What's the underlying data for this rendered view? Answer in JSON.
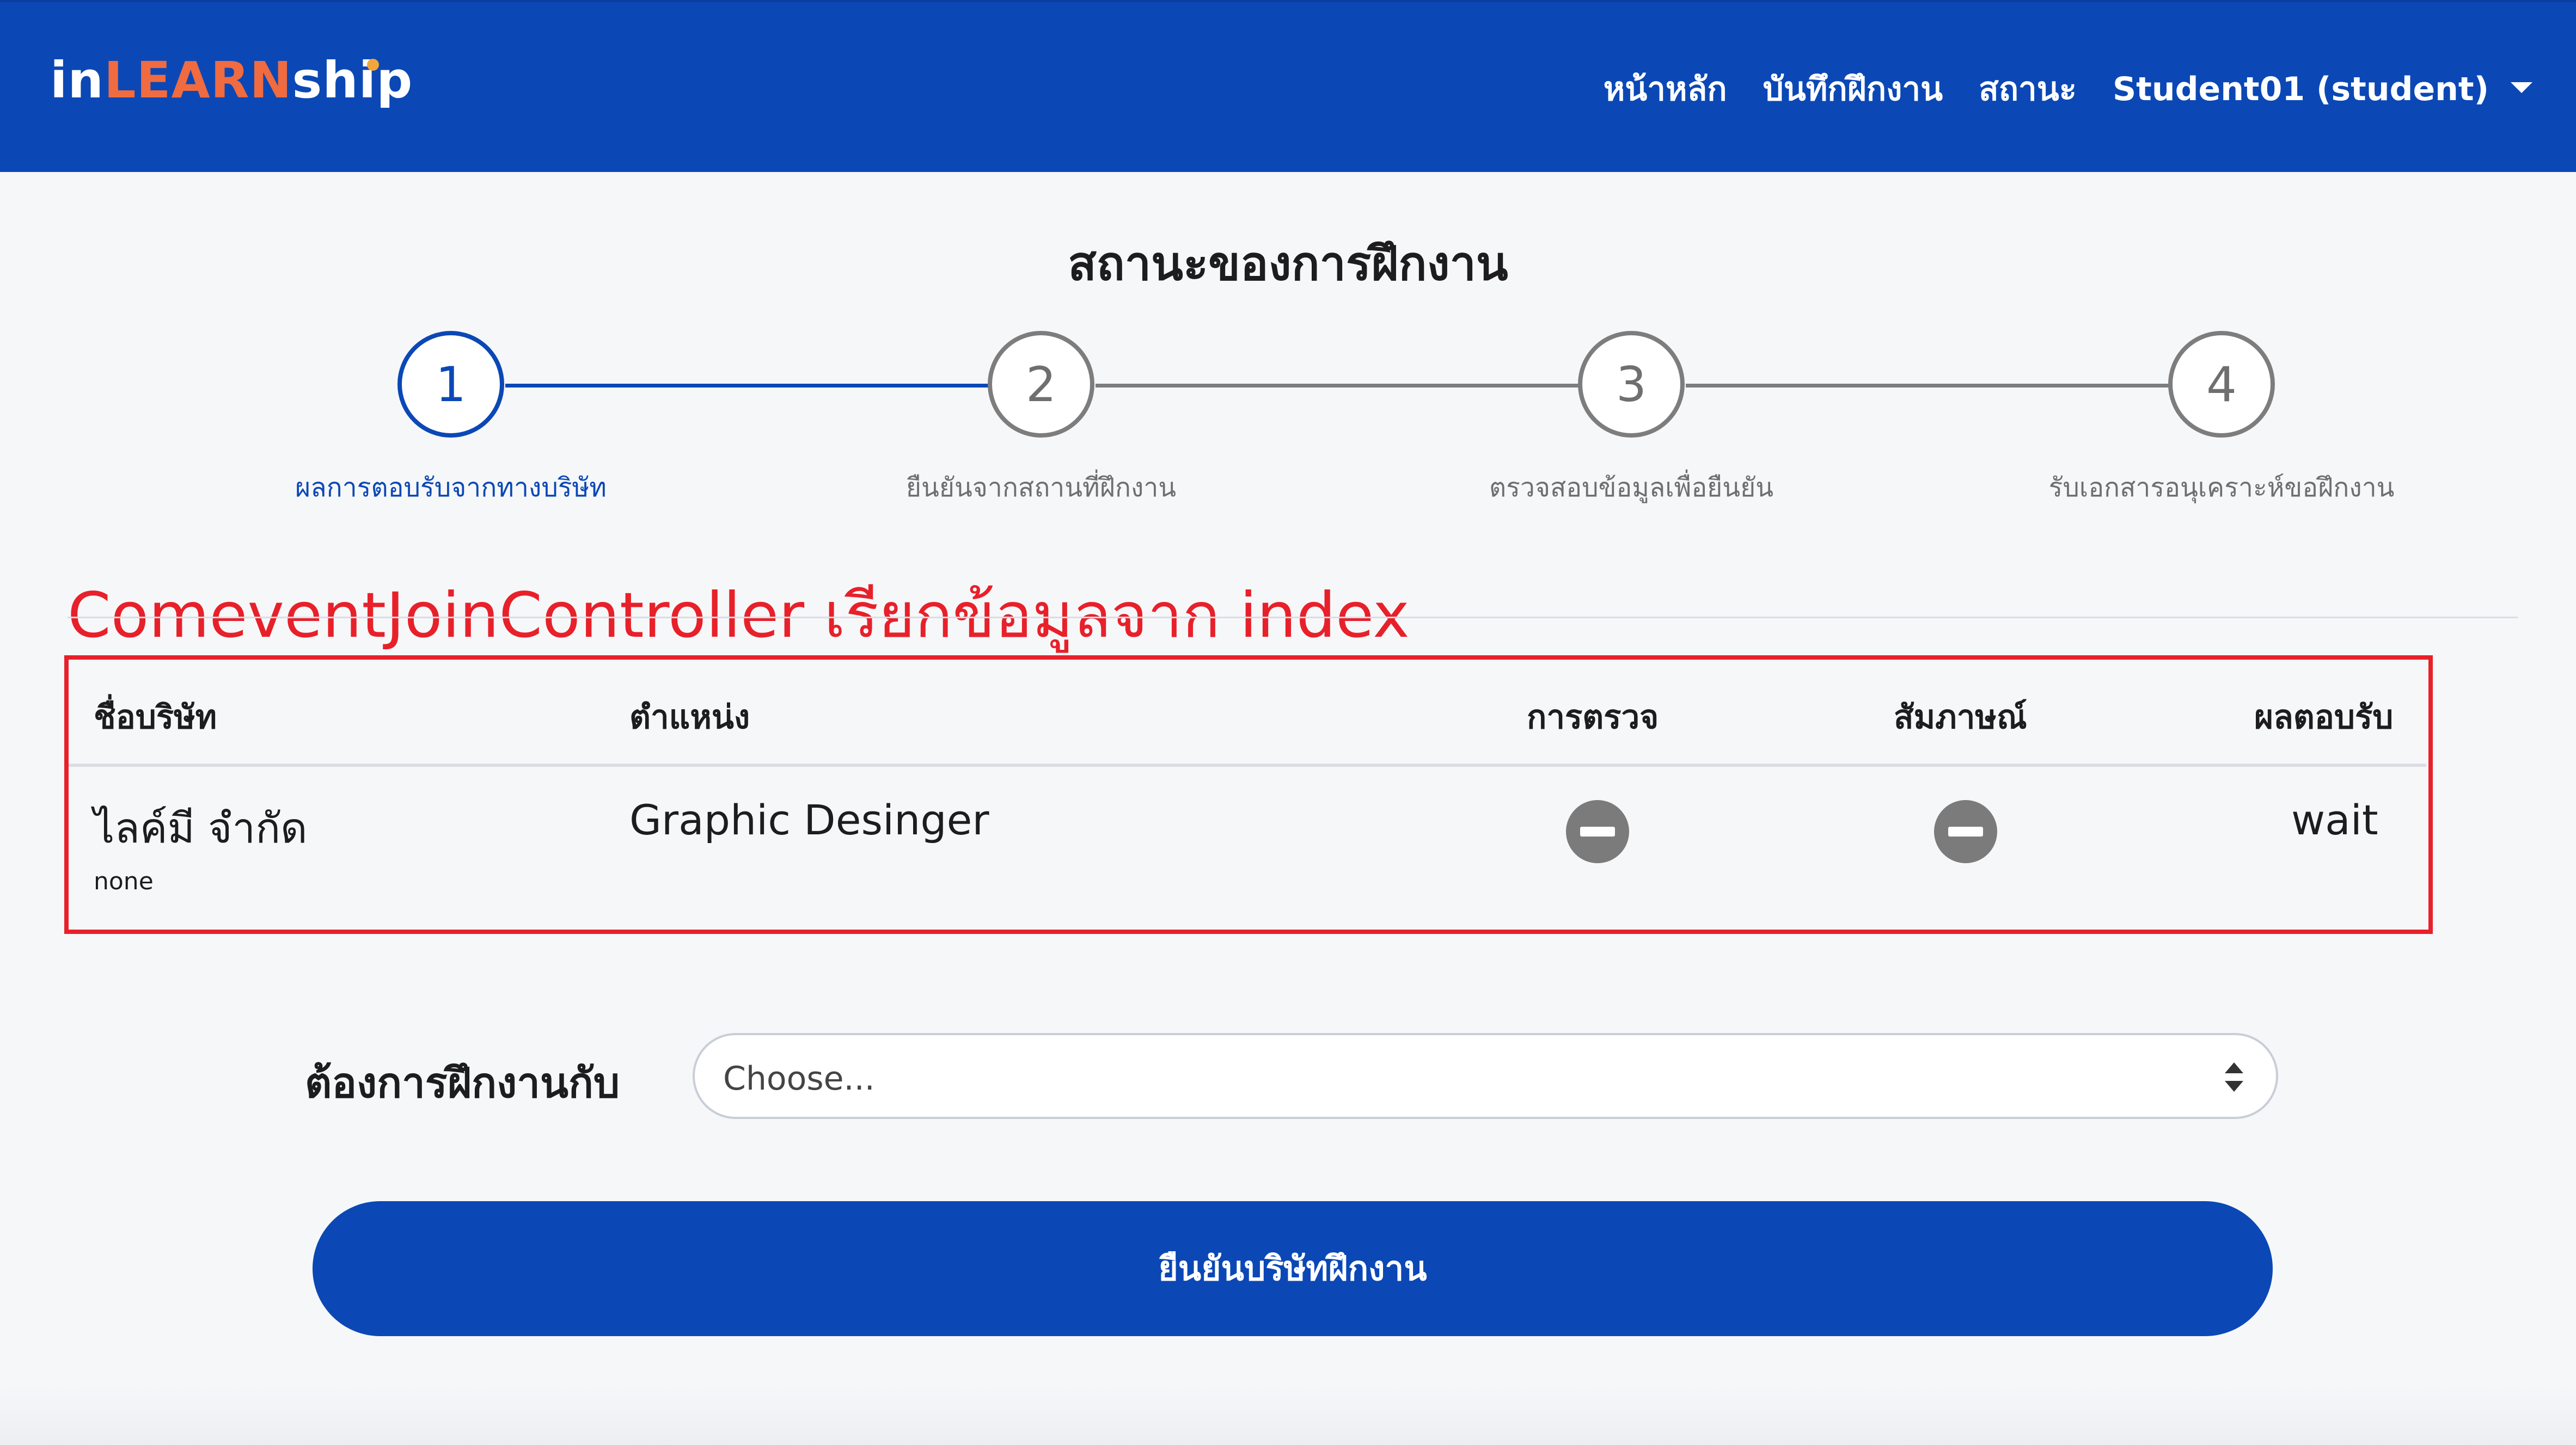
{
  "brand": {
    "prefix": "in",
    "middle": "LEARN",
    "suffix": "ship"
  },
  "nav": {
    "home": "หน้าหลัก",
    "log": "บันทึกฝึกงาน",
    "status": "สถานะ",
    "user": "Student01 (student)"
  },
  "page_title": "สถานะของการฝึกงาน",
  "stepper": {
    "current_step": 1,
    "steps": [
      {
        "number": "1",
        "label": "ผลการตอบรับจากทางบริษัท",
        "state": "active"
      },
      {
        "number": "2",
        "label": "ยืนยันจากสถานที่ฝึกงาน",
        "state": "inactive"
      },
      {
        "number": "3",
        "label": "ตรวจสอบข้อมูลเพื่อยืนยัน",
        "state": "inactive"
      },
      {
        "number": "4",
        "label": "รับเอกสารอนุเคราะห์ขอฝึกงาน",
        "state": "inactive"
      }
    ]
  },
  "annotation": "ComeventJoinController เรียกข้อมูลจาก index",
  "table": {
    "headers": [
      "ชื่อบริษัท",
      "ตำแหน่ง",
      "การตรวจ",
      "สัมภาษณ์",
      "ผลตอบรับ"
    ],
    "rows": [
      {
        "company": "ไลค์มี จำกัด",
        "company_note": "none",
        "position": "Graphic Desinger",
        "inspection": "minus-circle-icon",
        "interview": "minus-circle-icon",
        "result": "wait"
      }
    ]
  },
  "form": {
    "label": "ต้องการฝึกงานกับ",
    "select_value": "Choose...",
    "submit_label": "ยืนยันบริษัทฝึกงาน"
  },
  "colors": {
    "primary": "#0b48b6",
    "brand_accent": "#f06b3f",
    "annotation": "#e8202a",
    "icon_gray": "#7b7b7b"
  }
}
